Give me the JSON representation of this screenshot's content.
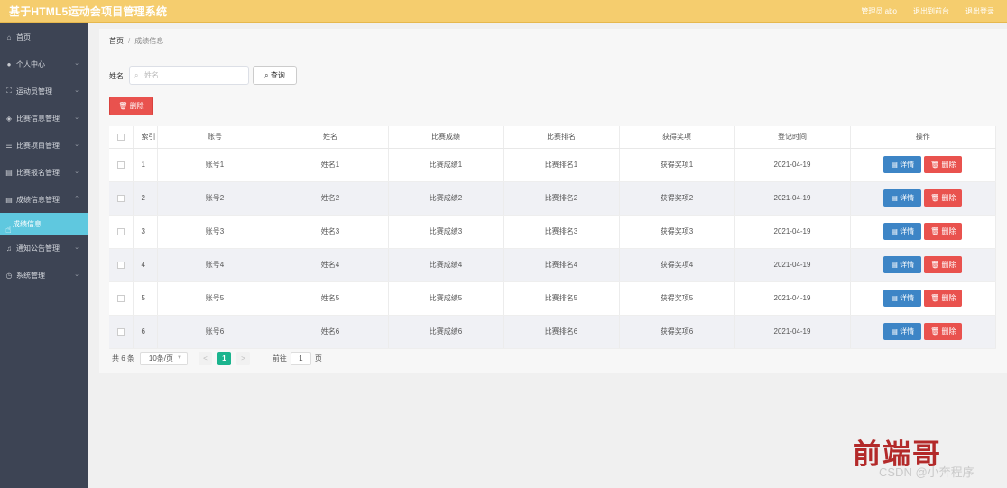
{
  "header": {
    "title": "基于HTML5运动会项目管理系统",
    "user": "管理员 abo",
    "home": "退出到前台",
    "logout": "退出登录"
  },
  "sidebar": {
    "items": [
      {
        "icon": "⌂",
        "label": "首页",
        "chev": ""
      },
      {
        "icon": "●",
        "label": "个人中心",
        "chev": "⌄"
      },
      {
        "icon": "⛶",
        "label": "运动员管理",
        "chev": "⌄"
      },
      {
        "icon": "◈",
        "label": "比赛信息管理",
        "chev": "⌄"
      },
      {
        "icon": "☰",
        "label": "比赛项目管理",
        "chev": "⌄"
      },
      {
        "icon": "▤",
        "label": "比赛报名管理",
        "chev": "⌄"
      },
      {
        "icon": "▤",
        "label": "成绩信息管理",
        "chev": "⌃"
      }
    ],
    "sub_active": "成绩信息",
    "items_after": [
      {
        "icon": "♫",
        "label": "通知公告管理",
        "chev": "⌄"
      },
      {
        "icon": "◷",
        "label": "系统管理",
        "chev": "⌄"
      }
    ]
  },
  "breadcrumb": {
    "home": "首页",
    "separator": "/",
    "current": "成绩信息"
  },
  "search": {
    "label": "姓名",
    "placeholder": "姓名",
    "button": "查询"
  },
  "delete_button": "删除",
  "table": {
    "headers": [
      "索引",
      "账号",
      "姓名",
      "比赛成绩",
      "比赛排名",
      "获得奖项",
      "登记时间",
      "操作"
    ],
    "rows": [
      {
        "idx": "1",
        "account": "账号1",
        "name": "姓名1",
        "score": "比赛成绩1",
        "rank": "比赛排名1",
        "award": "获得奖项1",
        "date": "2021-04-19"
      },
      {
        "idx": "2",
        "account": "账号2",
        "name": "姓名2",
        "score": "比赛成绩2",
        "rank": "比赛排名2",
        "award": "获得奖项2",
        "date": "2021-04-19"
      },
      {
        "idx": "3",
        "account": "账号3",
        "name": "姓名3",
        "score": "比赛成绩3",
        "rank": "比赛排名3",
        "award": "获得奖项3",
        "date": "2021-04-19"
      },
      {
        "idx": "4",
        "account": "账号4",
        "name": "姓名4",
        "score": "比赛成绩4",
        "rank": "比赛排名4",
        "award": "获得奖项4",
        "date": "2021-04-19"
      },
      {
        "idx": "5",
        "account": "账号5",
        "name": "姓名5",
        "score": "比赛成绩5",
        "rank": "比赛排名5",
        "award": "获得奖项5",
        "date": "2021-04-19"
      },
      {
        "idx": "6",
        "account": "账号6",
        "name": "姓名6",
        "score": "比赛成绩6",
        "rank": "比赛排名6",
        "award": "获得奖项6",
        "date": "2021-04-19"
      }
    ],
    "detail_label": "详情",
    "delete_label": "删除"
  },
  "pagination": {
    "total": "共 6 条",
    "page_size": "10条/页",
    "prev": "<",
    "current": "1",
    "next": ">",
    "goto": "前往",
    "goto_value": "1",
    "page_unit": "页"
  },
  "watermark": {
    "seal": "前端哥",
    "csdn": "CSDN @小奔程序"
  },
  "colors": {
    "header": "#f5cd6e",
    "sidebar": "#3d4454",
    "active_sub": "#5fc8df",
    "primary": "#3d85c6",
    "danger": "#e9524e",
    "pager_active": "#1bb48e"
  }
}
